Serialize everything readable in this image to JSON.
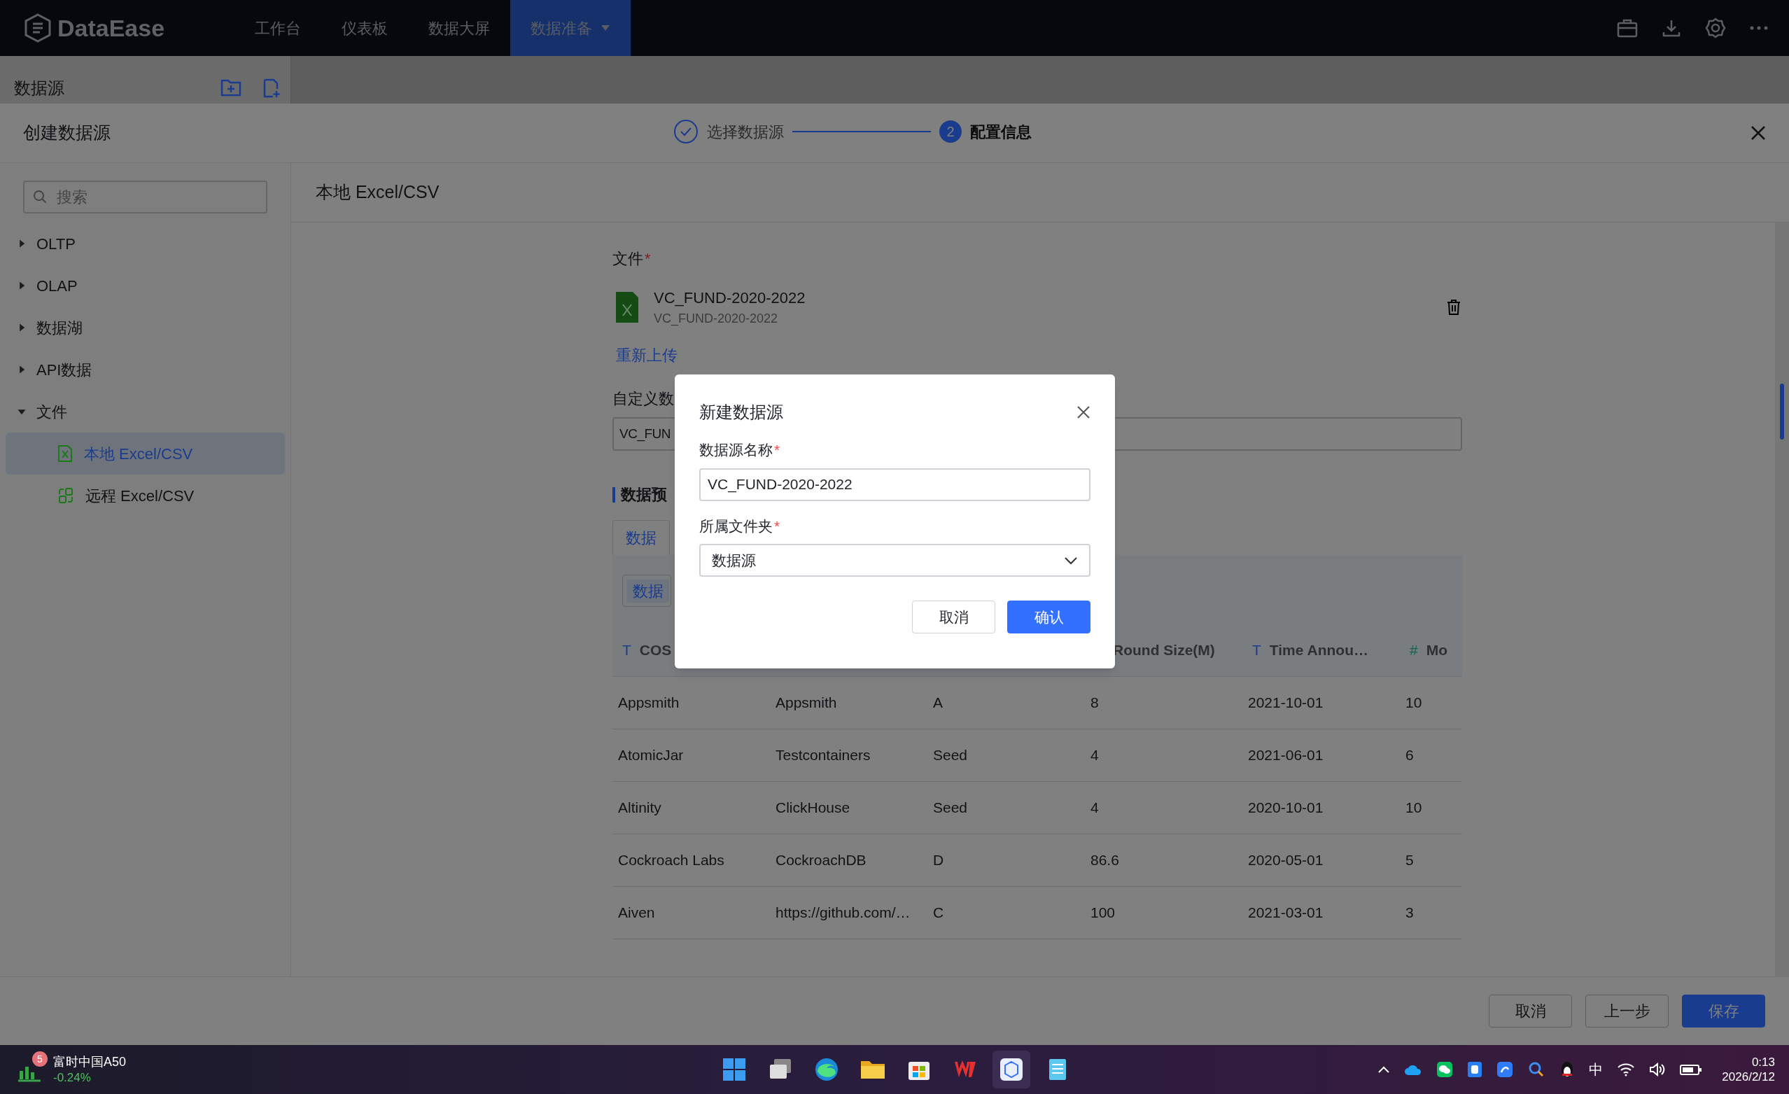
{
  "app_bar": {
    "logo": "DataEase",
    "nav": [
      {
        "label": "工作台",
        "selected": false
      },
      {
        "label": "仪表板",
        "selected": false
      },
      {
        "label": "数据大屏",
        "selected": false
      },
      {
        "label": "数据准备",
        "selected": true
      }
    ]
  },
  "side_header": {
    "title": "数据源"
  },
  "drawer": {
    "title": "创建数据源",
    "steps": [
      {
        "label": "选择数据源",
        "completed": true,
        "selected": false
      },
      {
        "number": "2",
        "label": "配置信息",
        "completed": false,
        "selected": true
      }
    ]
  },
  "sidebar": {
    "search": {
      "placeholder": "搜索"
    },
    "items": [
      {
        "label": "OLTP",
        "expanded": false
      },
      {
        "label": "OLAP",
        "expanded": false
      },
      {
        "label": "数据湖",
        "expanded": false
      },
      {
        "label": "API数据",
        "expanded": false
      },
      {
        "label": "文件",
        "expanded": true,
        "children": [
          {
            "label": "本地 Excel/CSV",
            "kind": "local",
            "selected": true
          },
          {
            "label": "远程 Excel/CSV",
            "kind": "remote",
            "selected": false
          }
        ]
      }
    ]
  },
  "content": {
    "title": "本地 Excel/CSV",
    "file_label": "文件",
    "required_mark": "*",
    "file": {
      "name": "VC_FUND-2020-2022",
      "sub": "VC_FUND-2020-2022"
    },
    "reupload": "重新上传",
    "custom_label": "自定义数",
    "custom_value": "VC_FUN",
    "preview_label": "数据预",
    "tabs": [
      {
        "label": "数据",
        "selected": true
      }
    ],
    "chip": "数据",
    "table": {
      "columns": [
        {
          "icon": "T",
          "label": "COS"
        },
        {},
        {},
        {
          "label": "Round Size(M)"
        },
        {
          "icon": "T",
          "label": "Time Annou…"
        },
        {
          "icon": "#",
          "label": "Mo"
        }
      ],
      "rows": [
        [
          "Appsmith",
          "Appsmith",
          "A",
          "8",
          "2021-10-01",
          "10"
        ],
        [
          "AtomicJar",
          "Testcontainers",
          "Seed",
          "4",
          "2021-06-01",
          "6"
        ],
        [
          "Altinity",
          "ClickHouse",
          "Seed",
          "4",
          "2020-10-01",
          "10"
        ],
        [
          "Cockroach Labs",
          "CockroachDB",
          "D",
          "86.6",
          "2020-05-01",
          "5"
        ],
        [
          "Aiven",
          "https://github.com/…",
          "C",
          "100",
          "2021-03-01",
          "3"
        ]
      ]
    }
  },
  "footer": {
    "buttons": [
      {
        "label": "取消",
        "kind": "plain"
      },
      {
        "label": "上一步",
        "kind": "plain"
      },
      {
        "label": "保存",
        "kind": "primary"
      }
    ]
  },
  "dialog": {
    "title": "新建数据源",
    "required_mark": "*",
    "name_label": "数据源名称",
    "name_value": "VC_FUND-2020-2022",
    "folder_label": "所属文件夹",
    "folder_value": "数据源",
    "buttons": [
      {
        "label": "取消",
        "kind": "plain"
      },
      {
        "label": "确认",
        "kind": "primary"
      }
    ]
  },
  "taskbar": {
    "widget": {
      "badge": "5",
      "title": "富时中国A50",
      "change": "-0.24%"
    },
    "ime": "中",
    "time": "0:13",
    "date": "2026/2/12"
  }
}
